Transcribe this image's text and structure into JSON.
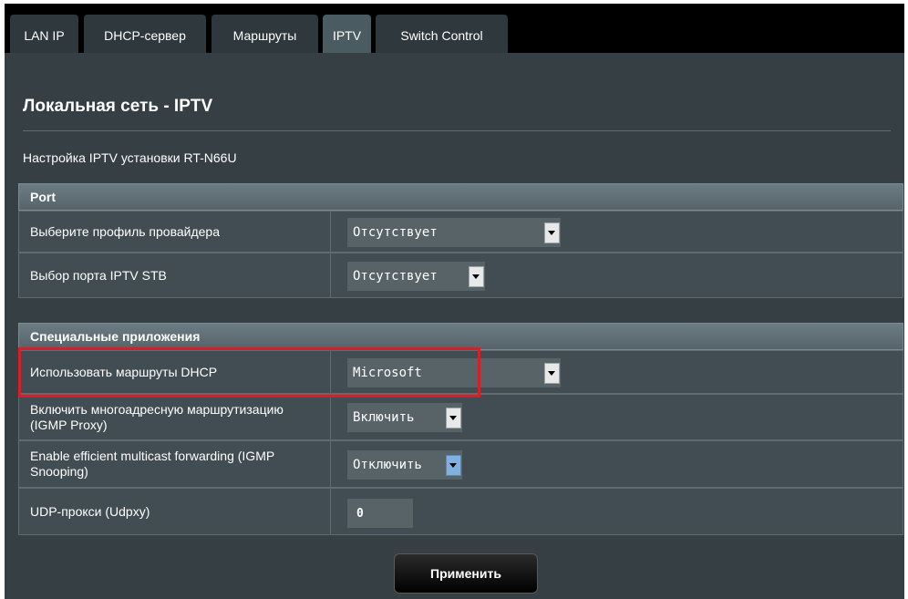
{
  "tabs": [
    {
      "label": "LAN IP"
    },
    {
      "label": "DHCP-сервер"
    },
    {
      "label": "Маршруты"
    },
    {
      "label": "IPTV"
    },
    {
      "label": "Switch Control"
    }
  ],
  "page": {
    "title": "Локальная сеть - IPTV",
    "description": "Настройка IPTV установки RT-N66U"
  },
  "port_section": {
    "header": "Port",
    "rows": [
      {
        "label": "Выберите профиль провайдера",
        "value": "Отсутствует"
      },
      {
        "label": "Выбор порта IPTV STB",
        "value": "Отсутствует"
      }
    ]
  },
  "apps_section": {
    "header": "Специальные приложения",
    "rows": [
      {
        "label": "Использовать маршруты DHCP",
        "value": "Microsoft"
      },
      {
        "label": "Включить многоадресную маршрутизацию (IGMP Proxy)",
        "value": "Включить"
      },
      {
        "label": "Enable efficient multicast forwarding (IGMP Snooping)",
        "value": "Отключить"
      },
      {
        "label": "UDP-прокси (Udpxy)",
        "value": "0"
      }
    ]
  },
  "apply_label": "Применить",
  "colors": {
    "highlight": "#d4202a",
    "active_tab": "#4b5b62"
  }
}
